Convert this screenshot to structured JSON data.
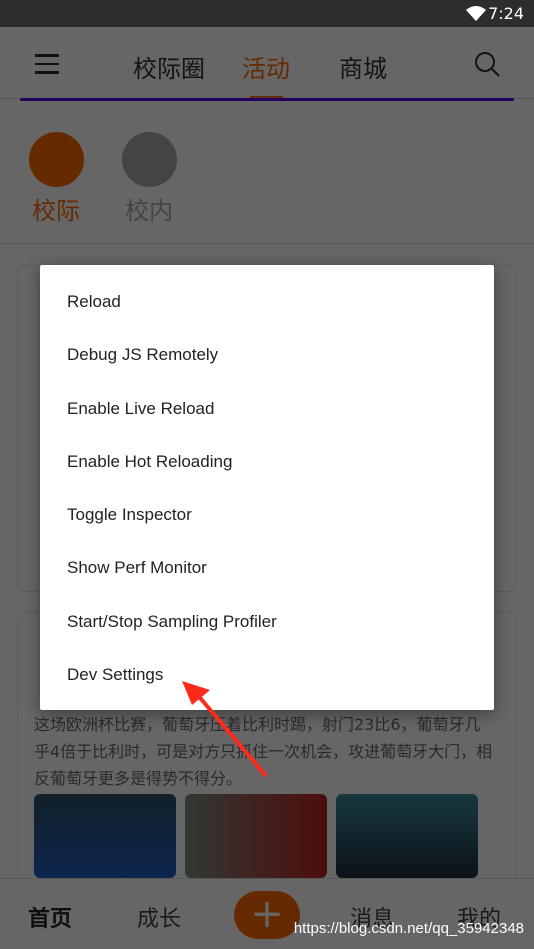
{
  "status": {
    "time": "7:24",
    "wifi_icon": "wifi-icon"
  },
  "header": {
    "tabs": [
      "校际圈",
      "活动",
      "商城"
    ],
    "active_tab": "活动"
  },
  "categories": [
    {
      "label": "校际",
      "active": true
    },
    {
      "label": "校内",
      "active": false
    }
  ],
  "card2": {
    "text": "这场欧洲杯比赛，葡萄牙压着比利时踢，射门23比6，葡萄牙几乎4倍于比利时，可是对方只抓住一次机会，攻进葡萄牙大门，相反葡萄牙更多是得势不得分。"
  },
  "bottom_nav": [
    "首页",
    "成长",
    "消息",
    "我的"
  ],
  "dev_menu": {
    "items": [
      "Reload",
      "Debug JS Remotely",
      "Enable Live Reload",
      "Enable Hot Reloading",
      "Toggle Inspector",
      "Show Perf Monitor",
      "Start/Stop Sampling Profiler",
      "Dev Settings"
    ]
  },
  "watermark": "https://blog.csdn.net/qq_35942348",
  "colors": {
    "accent": "#ff6a00",
    "annotation_arrow": "#ff2a1a"
  }
}
